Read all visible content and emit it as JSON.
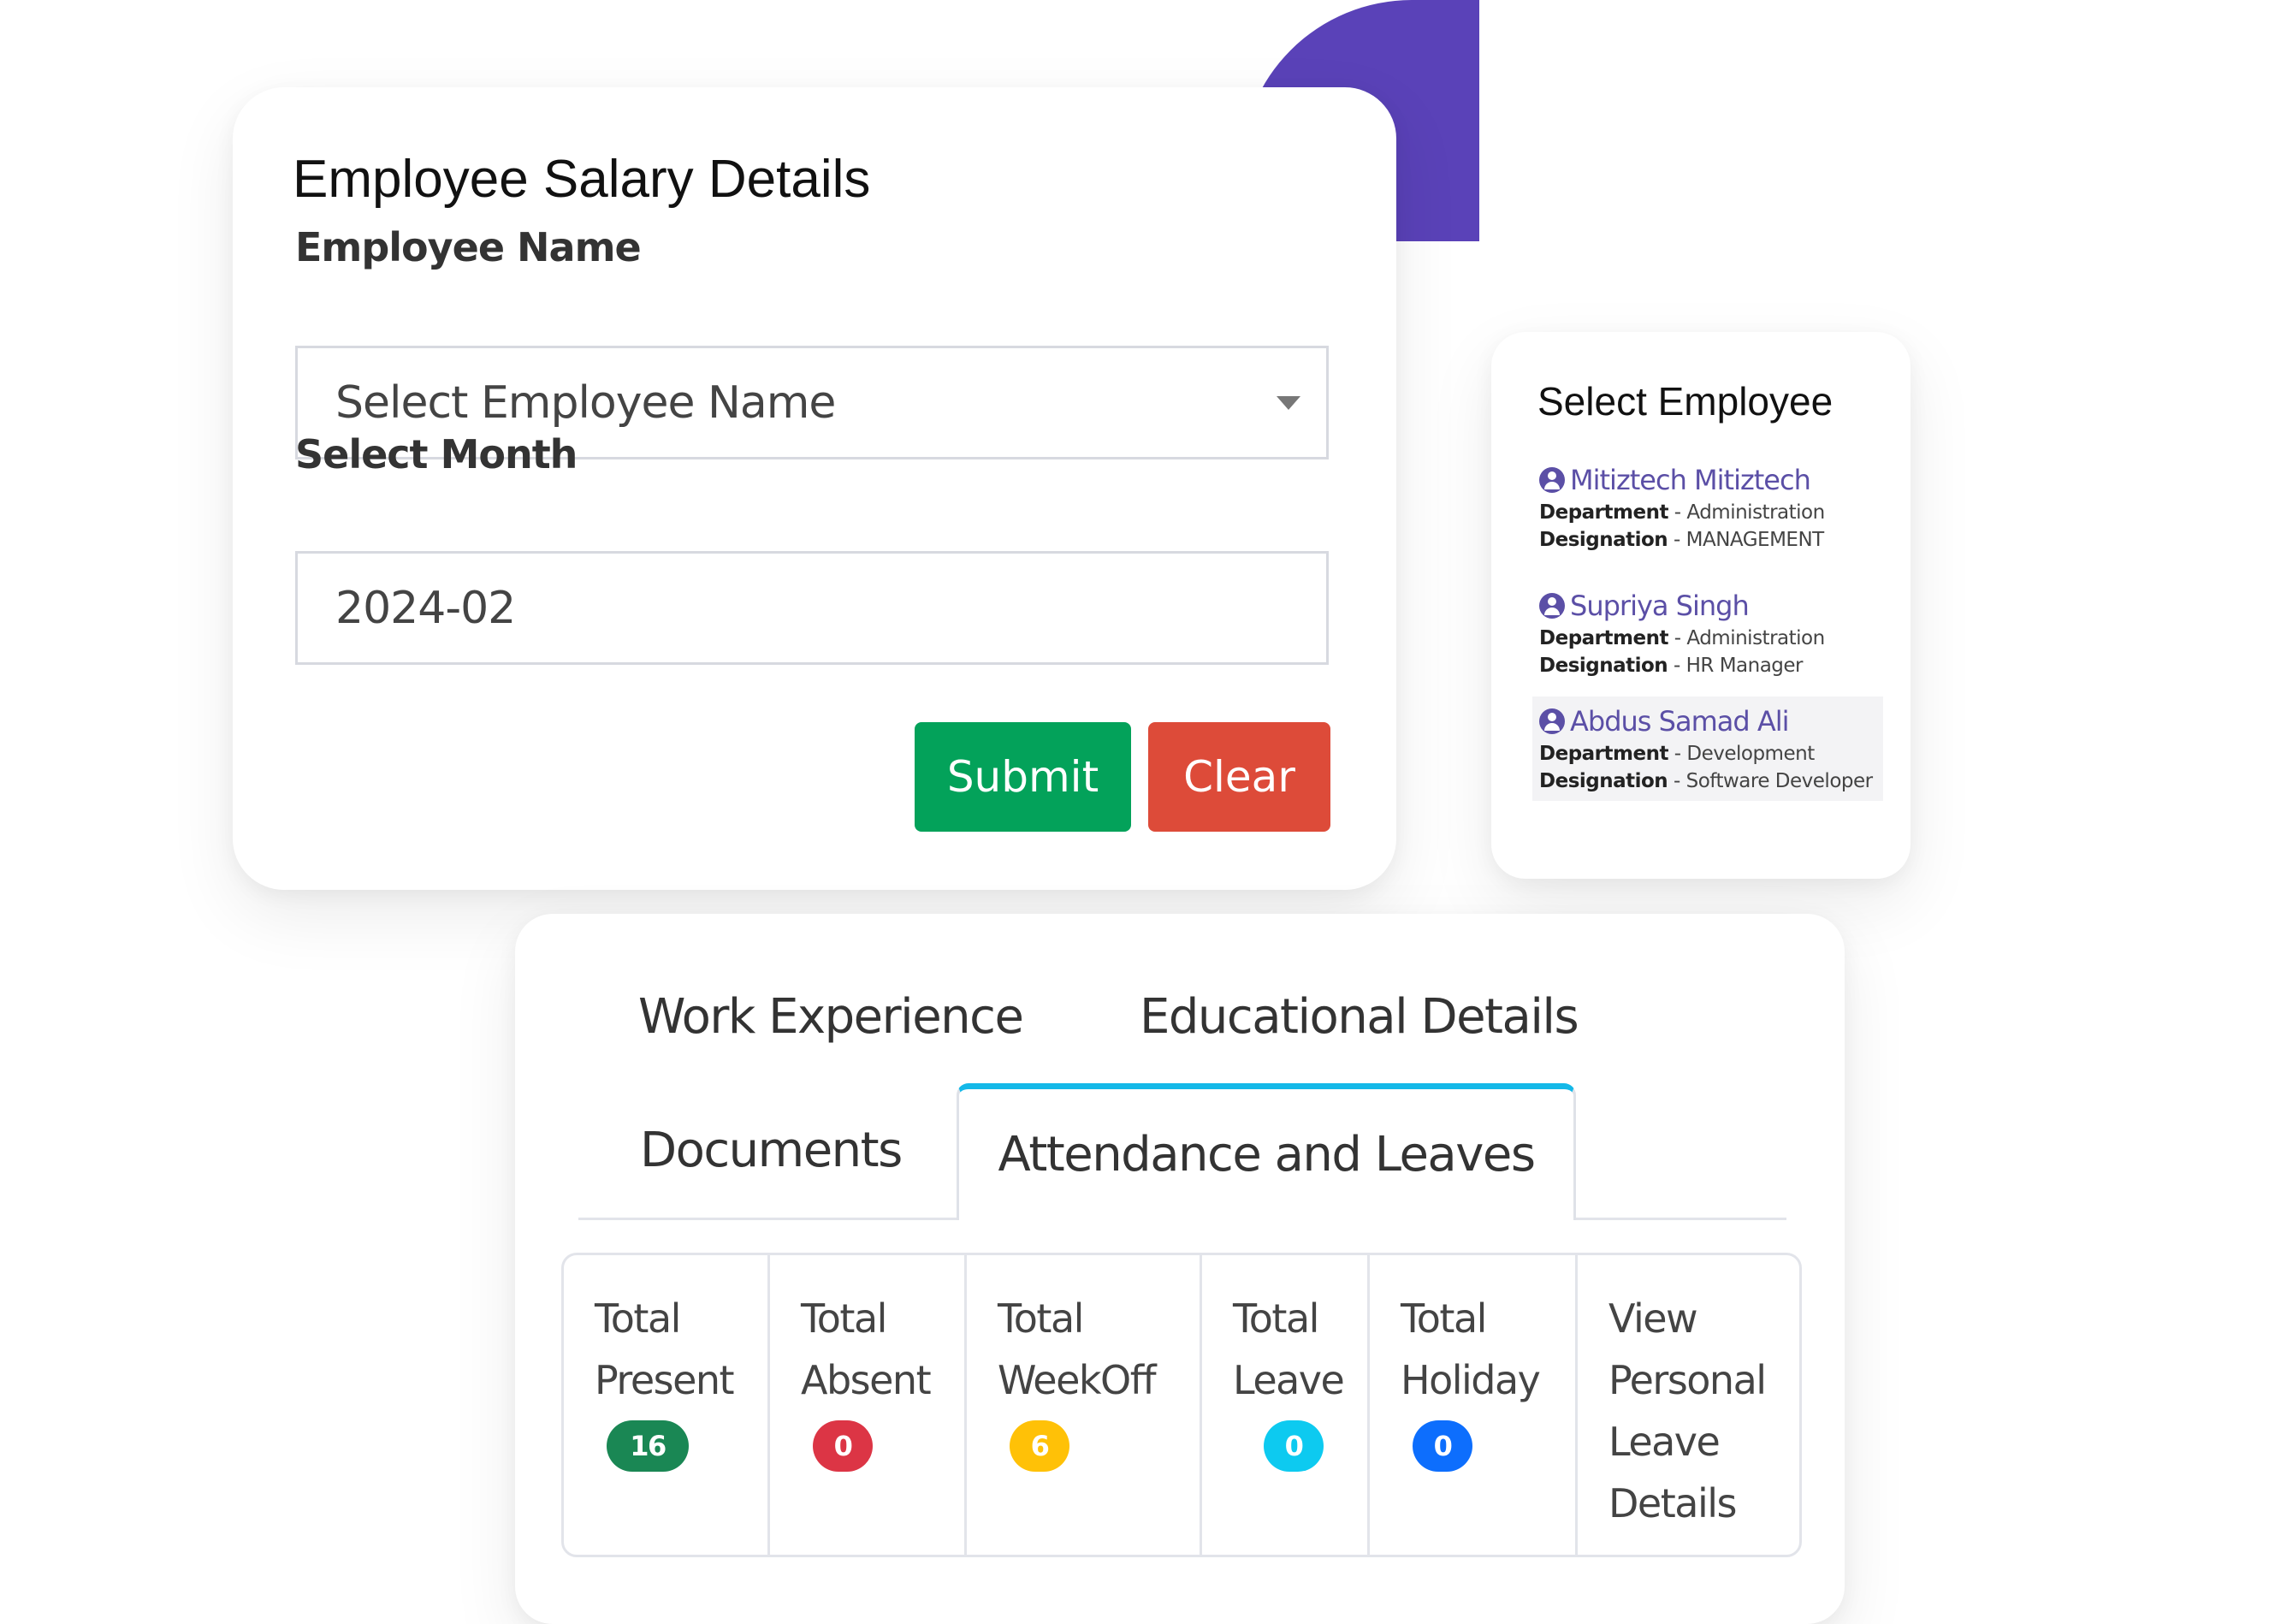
{
  "salary_form": {
    "title": "Employee Salary Details",
    "employee_label": "Employee Name",
    "employee_placeholder": "Select Employee Name",
    "month_label": "Select Month",
    "month_value": "2024-02",
    "submit_label": "Submit",
    "clear_label": "Clear"
  },
  "employee_picker": {
    "title": "Select Employee",
    "employees": [
      {
        "name": "Mitiztech Mitiztech",
        "department_label": "Department",
        "department": "Administration",
        "designation_label": "Designation",
        "designation": "MANAGEMENT"
      },
      {
        "name": "Supriya Singh",
        "department_label": "Department",
        "department": "Administration",
        "designation_label": "Designation",
        "designation": "HR Manager"
      },
      {
        "name": "Abdus Samad Ali",
        "department_label": "Department",
        "department": "Development",
        "designation_label": "Designation",
        "designation": "Software Developer"
      }
    ]
  },
  "tabs": {
    "items": [
      "Work Experience",
      "Educational Details",
      "Documents",
      "Attendance and Leaves"
    ],
    "active": "Attendance and Leaves"
  },
  "attendance": [
    {
      "line1": "Total",
      "line2": "Present",
      "count": "16",
      "color": "#1a8754"
    },
    {
      "line1": "Total",
      "line2": "Absent",
      "count": "0",
      "color": "#dc3545"
    },
    {
      "line1": "Total",
      "line2": "WeekOff",
      "count": "6",
      "color": "#ffc107"
    },
    {
      "line1": "Total",
      "line2": "Leave",
      "count": "0",
      "color": "#0dcaf0"
    },
    {
      "line1": "Total",
      "line2": "Holiday",
      "count": "0",
      "color": "#0d6efd"
    }
  ],
  "personal_leave_link": {
    "line1": "View",
    "line2": "Personal",
    "line3": "Leave",
    "line4": "Details"
  },
  "colors": {
    "brand_purple": "#5a42b8",
    "submit_green": "#03a25a",
    "clear_red": "#dd4b39",
    "active_tab_accent": "#14b8e8"
  }
}
